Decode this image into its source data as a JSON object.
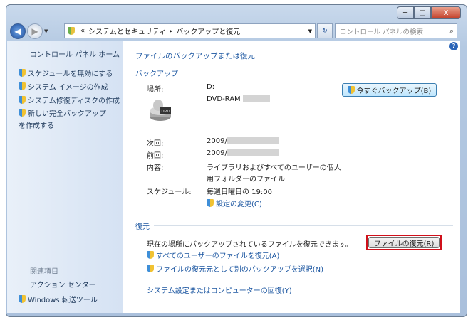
{
  "window": {
    "minimize": "─",
    "maximize": "□",
    "close": "X"
  },
  "address": {
    "back_icon": "arrow-left",
    "path_prefix": "«",
    "crumbs": [
      "システムとセキュリティ",
      "バックアップと復元"
    ],
    "separator": "▸"
  },
  "search": {
    "placeholder": "コントロール パネルの検索"
  },
  "sidebar": {
    "home": "コントロール パネル ホーム",
    "tasks": [
      "スケジュールを無効にする",
      "システム イメージの作成",
      "システム修復ディスクの作成",
      "新しい完全バックアップを作成する"
    ],
    "related_heading": "関連項目",
    "related": [
      "アクション センター",
      "Windows 転送ツール"
    ]
  },
  "main": {
    "title": "ファイルのバックアップまたは復元",
    "backup": {
      "heading": "バックアップ",
      "location_label": "場所:",
      "location_value": "D:",
      "location_device": "DVD-RAM",
      "backup_now": "今すぐバックアップ(B)",
      "drive_icon_label": "DVD",
      "next_label": "次回:",
      "next_value": "2009/",
      "last_label": "前回:",
      "last_value": "2009/",
      "contents_label": "内容:",
      "contents_value_1": "ライブラリおよびすべてのユーザーの個人",
      "contents_value_2": "用フォルダーのファイル",
      "schedule_label": "スケジュール:",
      "schedule_value": "毎週日曜日の 19:00",
      "change_settings": "設定の変更(C)"
    },
    "restore": {
      "heading": "復元",
      "description": "現在の場所にバックアップされているファイルを復元できます。",
      "restore_files": "ファイルの復元(R)",
      "restore_all_users": "すべてのユーザーのファイルを復元(A)",
      "select_other": "ファイルの復元元として別のバックアップを選択(N)",
      "recover_system": "システム設定またはコンピューターの回復(Y)"
    },
    "highlight_color": "#d0101a"
  }
}
